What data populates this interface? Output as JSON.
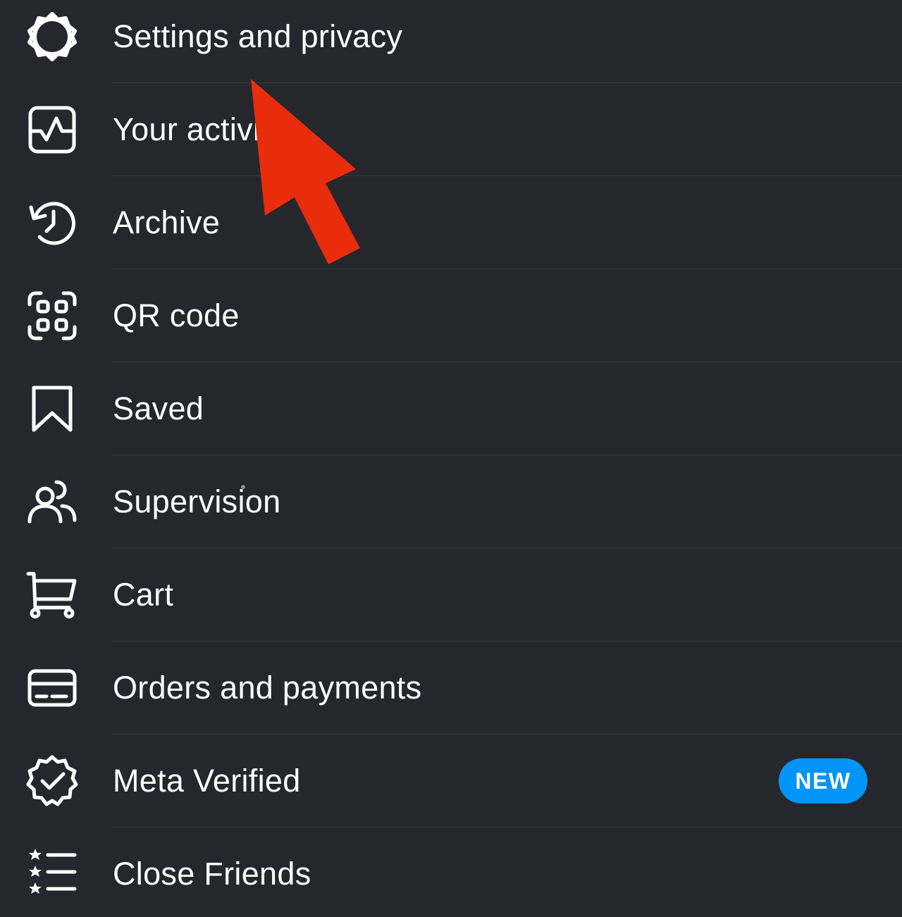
{
  "menu": {
    "items": [
      {
        "label": "Settings and privacy",
        "icon": "gear-icon"
      },
      {
        "label": "Your activity",
        "icon": "activity-icon"
      },
      {
        "label": "Archive",
        "icon": "archive-clock-icon"
      },
      {
        "label": "QR code",
        "icon": "qr-code-icon"
      },
      {
        "label": "Saved",
        "icon": "bookmark-icon"
      },
      {
        "label": "Supervision",
        "icon": "supervision-people-icon"
      },
      {
        "label": "Cart",
        "icon": "cart-icon"
      },
      {
        "label": "Orders and payments",
        "icon": "credit-card-icon"
      },
      {
        "label": "Meta Verified",
        "icon": "verified-badge-icon",
        "badge": "NEW"
      },
      {
        "label": "Close Friends",
        "icon": "close-friends-list-icon"
      }
    ]
  },
  "colors": {
    "background": "#25272c",
    "text": "#ffffff",
    "divider": "#34363c",
    "badge": "#0095f6",
    "annotation_arrow": "#e82c0c"
  }
}
